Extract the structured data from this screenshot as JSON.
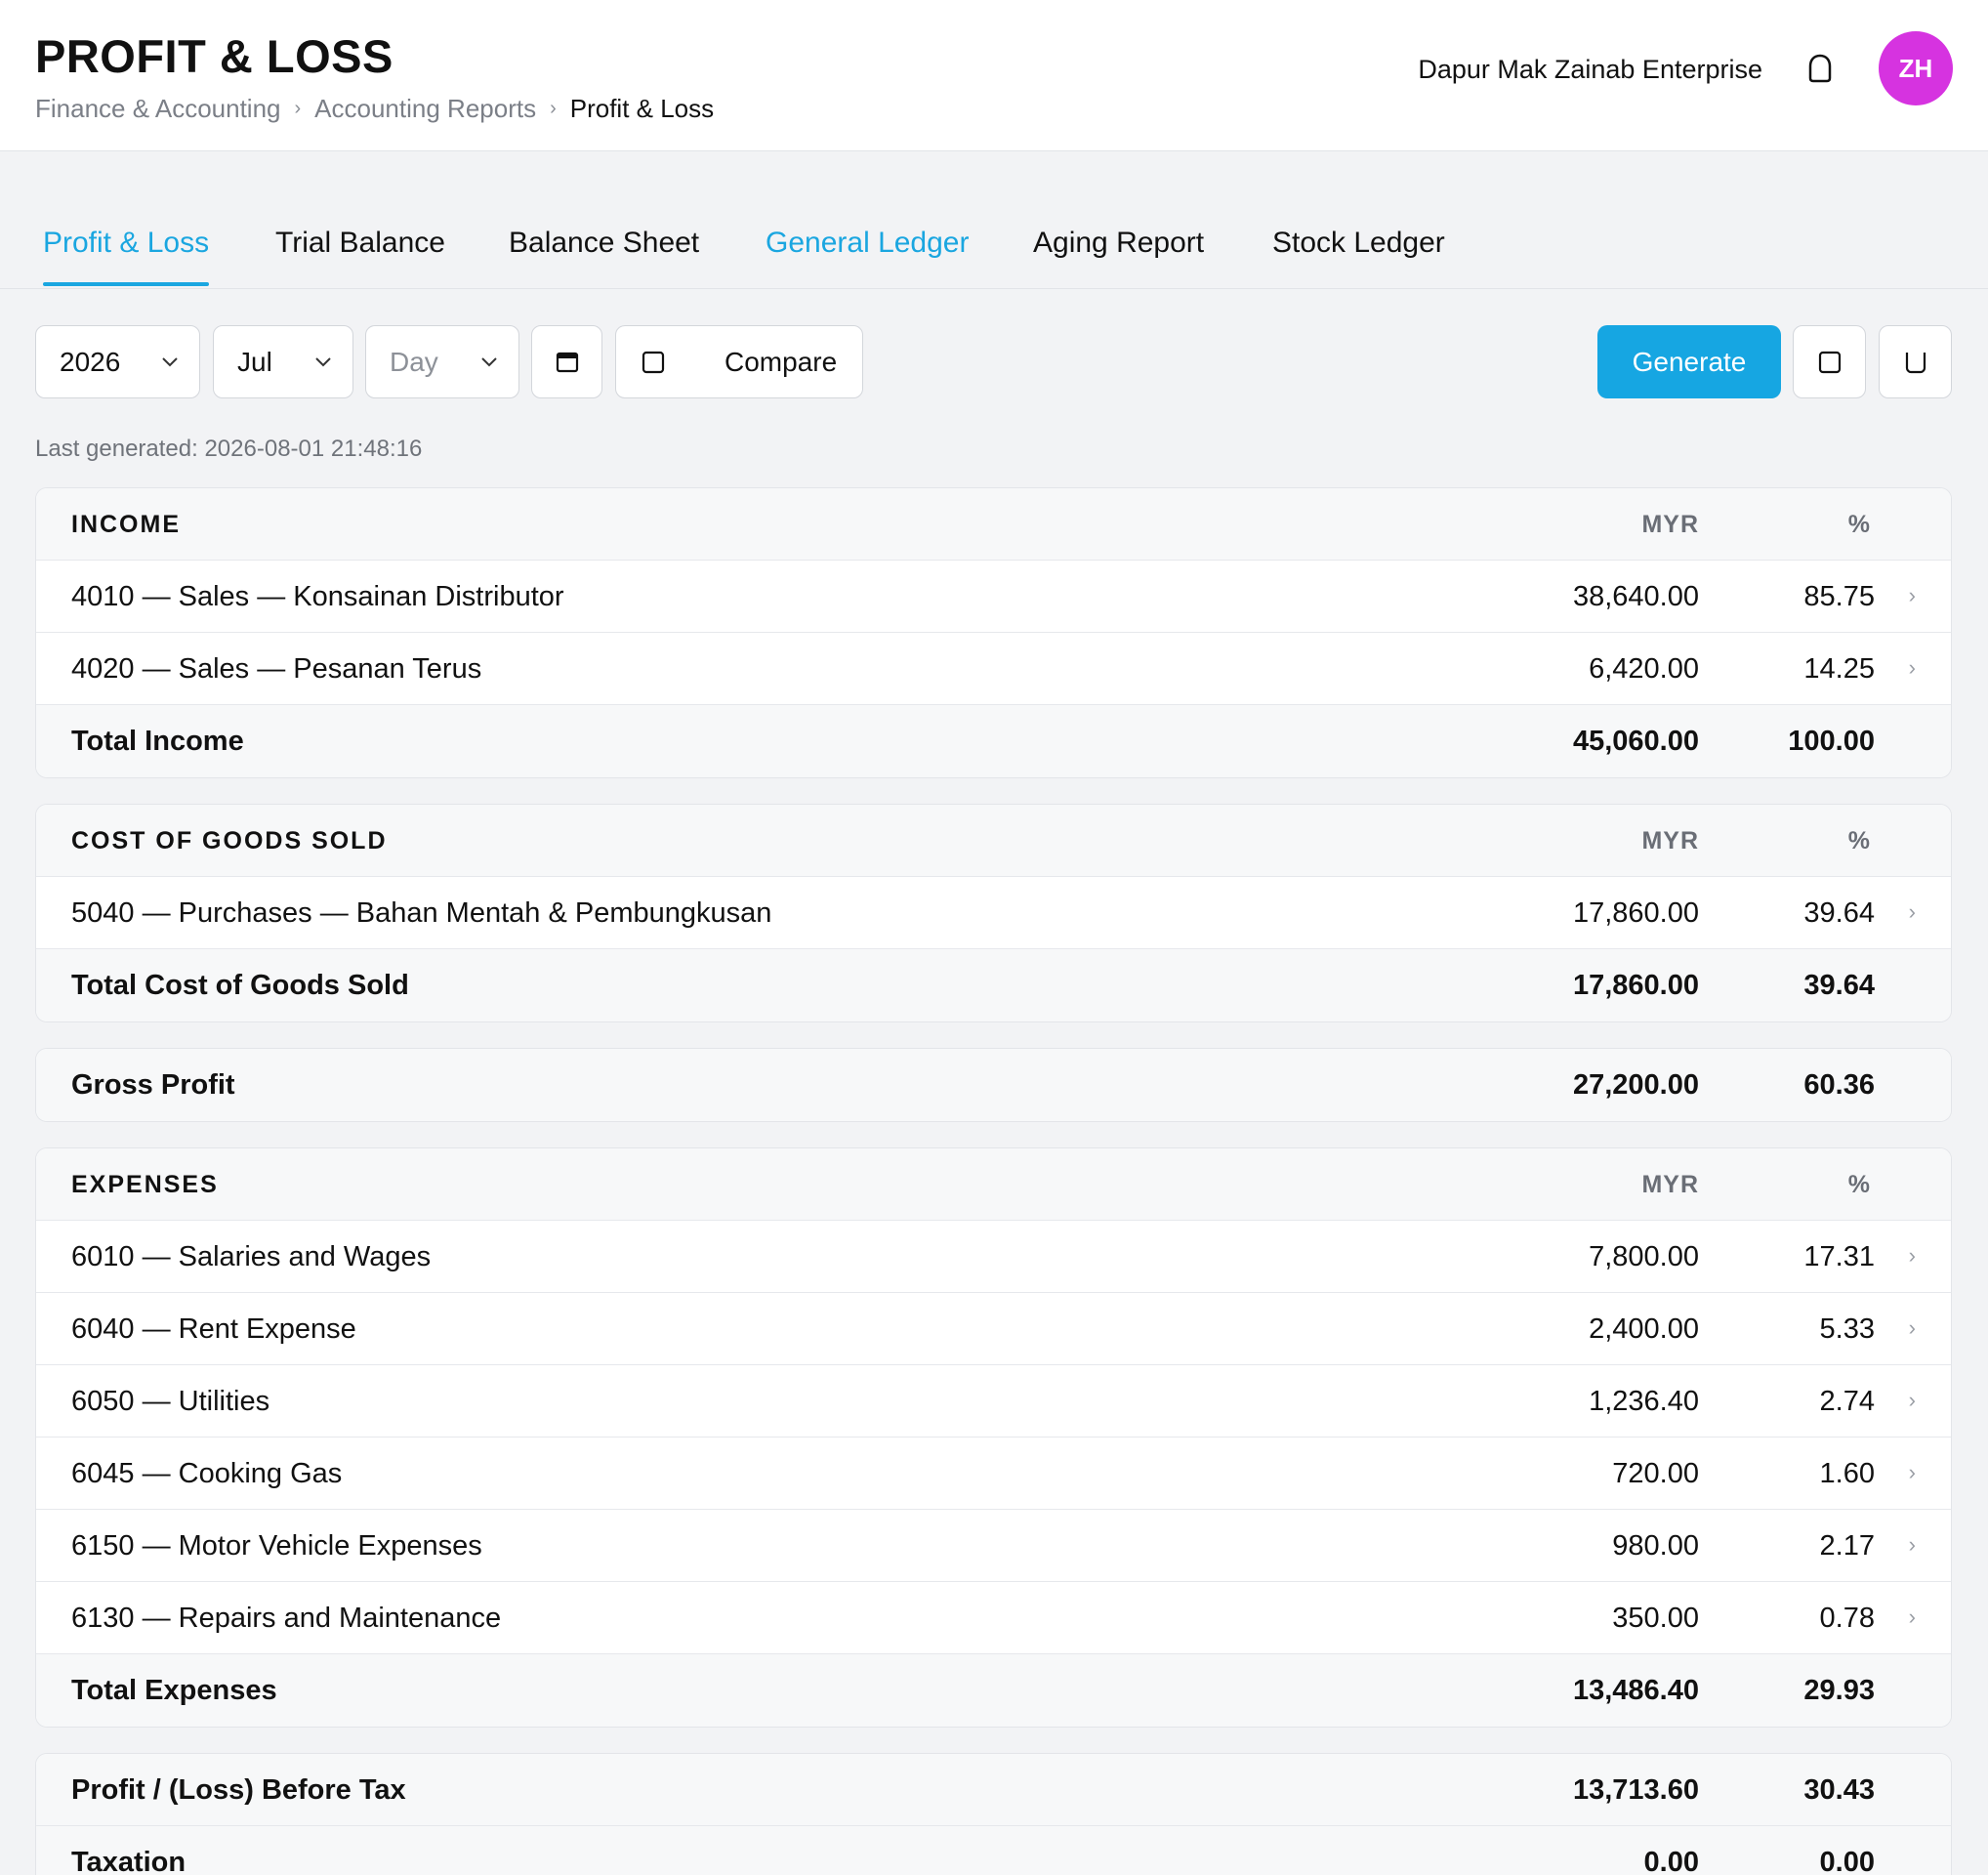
{
  "header": {
    "title": "PROFIT & LOSS",
    "breadcrumb": [
      "Finance & Accounting",
      "Accounting Reports",
      "Profit & Loss"
    ],
    "breadcrumb_sep": "›",
    "company": "Dapur Mak Zainab Enterprise",
    "avatar_initials": "ZH",
    "avatar_color": "#d633e0"
  },
  "tabs": [
    {
      "label": "Profit & Loss"
    },
    {
      "label": "Trial Balance"
    },
    {
      "label": "Balance Sheet"
    },
    {
      "label": "General Ledger"
    },
    {
      "label": "Aging Report"
    },
    {
      "label": "Stock Ledger"
    }
  ],
  "filters": {
    "year": "2026",
    "month": "Jul",
    "day_placeholder": "Day",
    "compare_label": "Compare",
    "generate_label": "Generate"
  },
  "last_generated": "Last generated: 2026-08-01 21:48:16",
  "columns": {
    "amount": "MYR",
    "percent": "%"
  },
  "income": {
    "heading": "INCOME",
    "rows": [
      {
        "label": "4010 — Sales — Konsainan Distributor",
        "amount": "38,640.00",
        "pct": "85.75"
      },
      {
        "label": "4020 — Sales — Pesanan Terus",
        "amount": "6,420.00",
        "pct": "14.25"
      }
    ],
    "total": {
      "label": "Total Income",
      "amount": "45,060.00",
      "pct": "100.00"
    }
  },
  "cogs": {
    "heading": "COST OF GOODS SOLD",
    "rows": [
      {
        "label": "5040 — Purchases — Bahan Mentah & Pembungkusan",
        "amount": "17,860.00",
        "pct": "39.64"
      }
    ],
    "total": {
      "label": "Total Cost of Goods Sold",
      "amount": "17,860.00",
      "pct": "39.64"
    }
  },
  "gross_profit": {
    "label": "Gross Profit",
    "amount": "27,200.00",
    "pct": "60.36"
  },
  "expenses": {
    "heading": "EXPENSES",
    "rows": [
      {
        "label": "6010 — Salaries and Wages",
        "amount": "7,800.00",
        "pct": "17.31"
      },
      {
        "label": "6040 — Rent Expense",
        "amount": "2,400.00",
        "pct": "5.33"
      },
      {
        "label": "6050 — Utilities",
        "amount": "1,236.40",
        "pct": "2.74"
      },
      {
        "label": "6045 — Cooking Gas",
        "amount": "720.00",
        "pct": "1.60"
      },
      {
        "label": "6150 — Motor Vehicle Expenses",
        "amount": "980.00",
        "pct": "2.17"
      },
      {
        "label": "6130 — Repairs and Maintenance",
        "amount": "350.00",
        "pct": "0.78"
      }
    ],
    "total": {
      "label": "Total Expenses",
      "amount": "13,486.40",
      "pct": "29.93"
    }
  },
  "before_tax": {
    "label": "Profit / (Loss) Before Tax",
    "amount": "13,713.60",
    "pct": "30.43"
  },
  "taxation": {
    "label": "Taxation",
    "amount": "0.00",
    "pct": "0.00"
  },
  "row_arrow": "›",
  "accent_color": "#1aa6e0"
}
